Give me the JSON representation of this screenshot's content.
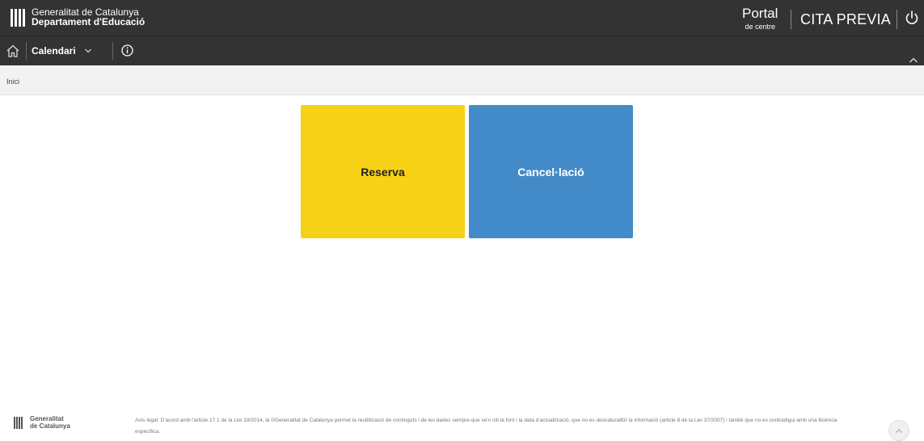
{
  "header": {
    "org_line1": "Generalitat de Catalunya",
    "org_line2": "Departament d'Educació",
    "portal_title": "Portal",
    "portal_subtitle": "de centre",
    "app_title": "CITA PREVIA",
    "logo_icon": "gencat-logo-icon",
    "power_icon": "power-icon"
  },
  "nav": {
    "home_icon": "home-icon",
    "menu_label": "Calendari",
    "menu_icon": "chevron-down-icon",
    "info_icon": "info-icon",
    "collapse_icon": "chevron-up-icon"
  },
  "breadcrumb": {
    "items": [
      "Inici"
    ]
  },
  "tiles": [
    {
      "label": "Reserva",
      "color": "#f6d116"
    },
    {
      "label": "Cancel·lació",
      "color": "#428bc8"
    }
  ],
  "footer": {
    "brand_line1": "Generalitat",
    "brand_line2": "de Catalunya",
    "legal_text": "Avís legal: D'acord amb l'article 17.1 de la Llei 19/2014, la ©Generalitat de Catalunya permet la reutilització de continguts i de les dades sempre que se'n citi la font i la data d'actualització, que no es desnaturalitzi la informació (article 8 de la Llei 37/2007) i també que no es contradigui amb una llicència específica.",
    "scroll_top_icon": "chevron-up-icon"
  },
  "colors": {
    "header_bg": "#333333",
    "breadcrumb_bg": "#f2f2f2"
  }
}
